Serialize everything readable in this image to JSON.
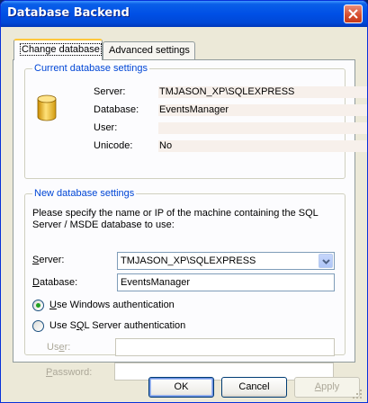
{
  "window": {
    "title": "Database Backend"
  },
  "tabs": [
    {
      "label": "Change database"
    },
    {
      "label": "Advanced settings"
    }
  ],
  "current_settings": {
    "group_title": "Current database settings",
    "rows": [
      {
        "label": "Server:",
        "value": "TMJASON_XP\\SQLEXPRESS"
      },
      {
        "label": "Database:",
        "value": "EventsManager"
      },
      {
        "label": "User:",
        "value": ""
      },
      {
        "label": "Unicode:",
        "value": "No"
      }
    ]
  },
  "new_settings": {
    "group_title": "New database settings",
    "description": "Please specify the name or IP of the machine containing the SQL Server / MSDE database to use:",
    "server": {
      "label_key": "S",
      "label_rest": "erver:",
      "value": "TMJASON_XP\\SQLEXPRESS"
    },
    "database": {
      "label_key": "D",
      "label_rest": "atabase:",
      "value": "EventsManager"
    },
    "auth_windows": {
      "label_key": "U",
      "label_rest": "se Windows authentication",
      "selected": true
    },
    "auth_sql": {
      "label_pre": "Use S",
      "label_key": "Q",
      "label_rest": "L Server authentication",
      "selected": false
    },
    "user": {
      "label_pre": "Us",
      "label_key": "e",
      "label_rest": "r:",
      "value": ""
    },
    "password": {
      "label_key": "P",
      "label_rest": "assword:",
      "value": ""
    }
  },
  "buttons": {
    "ok": "OK",
    "cancel": "Cancel",
    "apply_key": "A",
    "apply_rest": "pply"
  },
  "colors": {
    "title_bar": "#0054E3",
    "group_title": "#0046D5",
    "close_button": "#D64C2B",
    "radio_selected": "#21A121"
  }
}
